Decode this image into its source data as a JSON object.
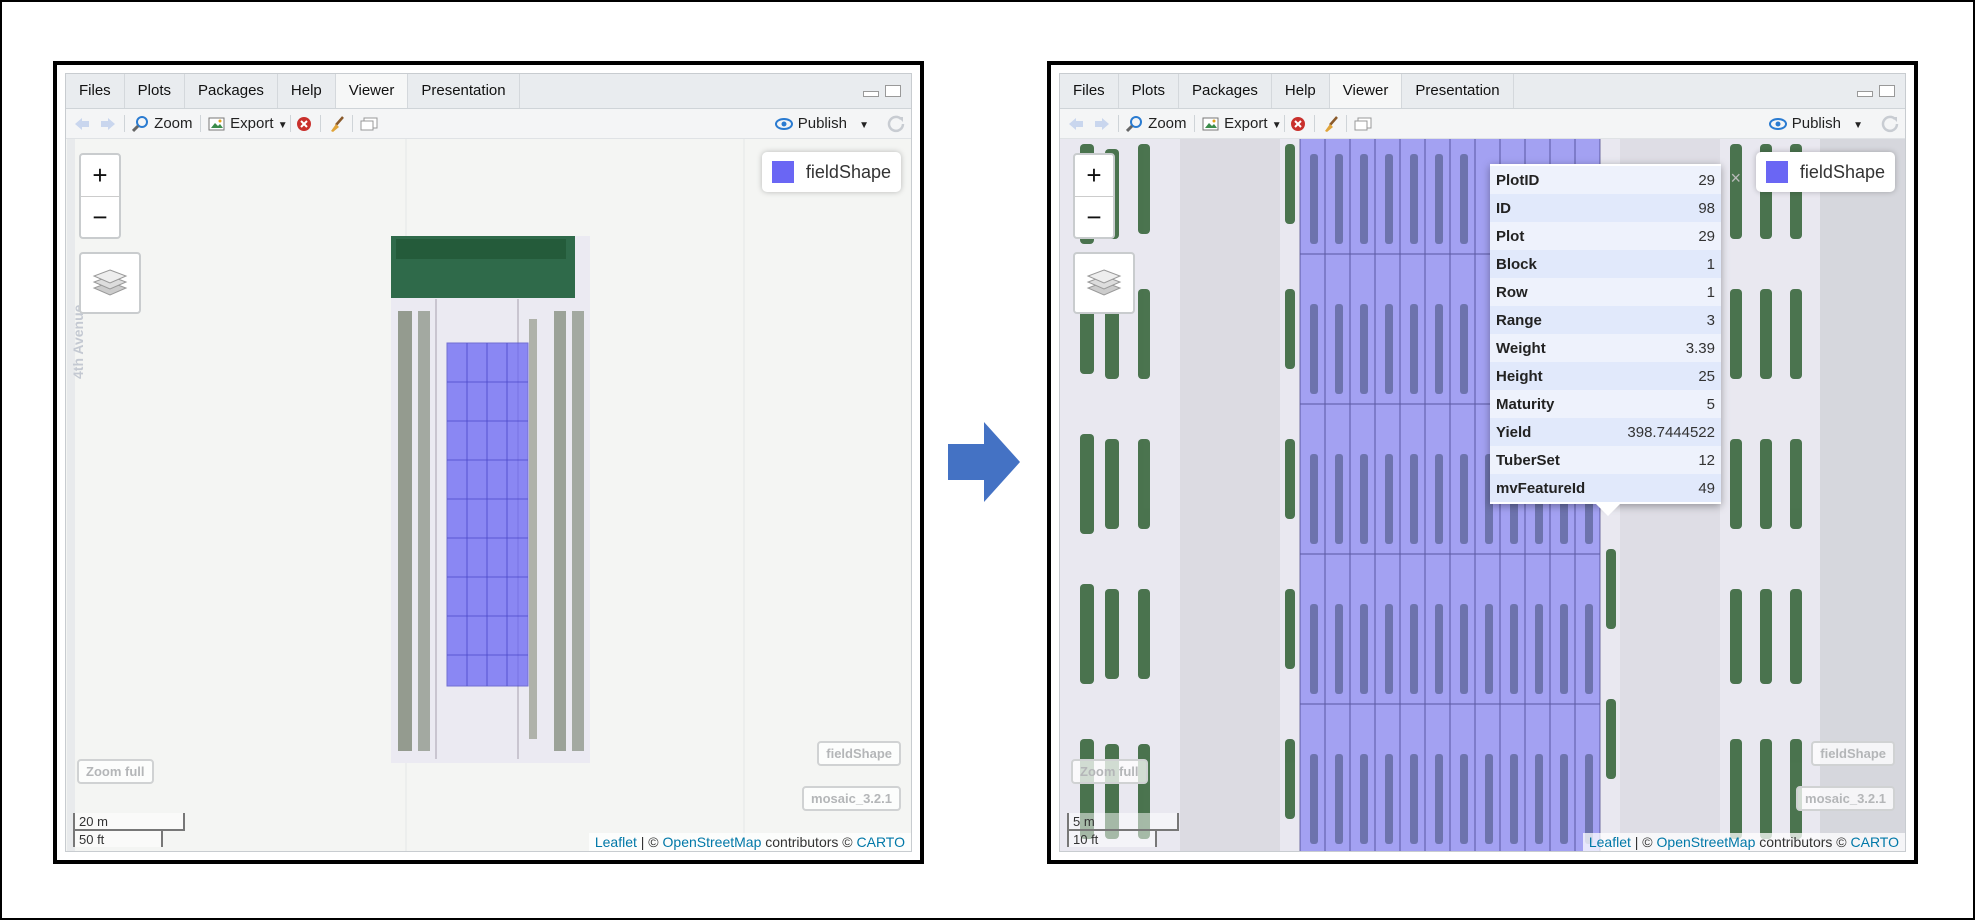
{
  "tabs": [
    "Files",
    "Plots",
    "Packages",
    "Help",
    "Viewer",
    "Presentation"
  ],
  "active_tab": "Viewer",
  "toolbar": {
    "zoom_label": "Zoom",
    "export_label": "Export",
    "publish_label": "Publish"
  },
  "left_map": {
    "street_label": "4th Avenue",
    "legend_label": "fieldShape",
    "zoom_full": "Zoom full",
    "layer_buttons": [
      "fieldShape",
      "mosaic_3.2.1"
    ],
    "scale_metric": "20 m",
    "scale_imperial": "50 ft"
  },
  "right_map": {
    "legend_label": "fieldShape",
    "zoom_full": "Zoom full",
    "layer_buttons": [
      "fieldShape",
      "mosaic_3.2.1"
    ],
    "scale_metric": "5 m",
    "scale_imperial": "10 ft",
    "popup": {
      "close": "×",
      "rows": [
        {
          "key": "PlotID",
          "value": "29"
        },
        {
          "key": "ID",
          "value": "98"
        },
        {
          "key": "Plot",
          "value": "29"
        },
        {
          "key": "Block",
          "value": "1"
        },
        {
          "key": "Row",
          "value": "1"
        },
        {
          "key": "Range",
          "value": "3"
        },
        {
          "key": "Weight",
          "value": "3.39"
        },
        {
          "key": "Height",
          "value": "25"
        },
        {
          "key": "Maturity",
          "value": "5"
        },
        {
          "key": "Yield",
          "value": "398.7444522"
        },
        {
          "key": "TuberSet",
          "value": "12"
        },
        {
          "key": "mvFeatureId",
          "value": "49"
        }
      ]
    }
  },
  "attribution": {
    "leaflet": "Leaflet",
    "sep": " | © ",
    "osm": "OpenStreetMap",
    "contributors": " contributors © ",
    "carto": "CARTO"
  },
  "colors": {
    "field_shape": "#6a66f4",
    "arrow": "#4472c4",
    "link": "#0078a8"
  }
}
